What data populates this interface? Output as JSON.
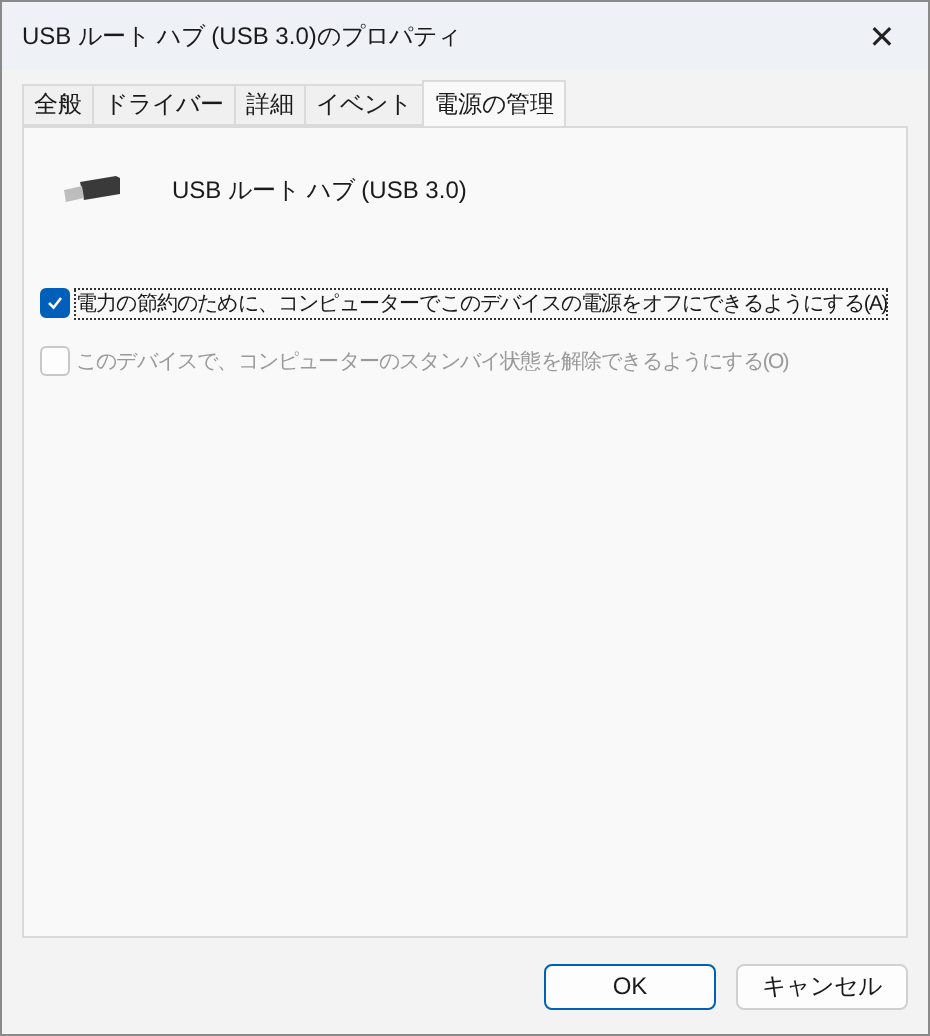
{
  "window": {
    "title": "USB ルート ハブ (USB 3.0)のプロパティ",
    "close": "✕"
  },
  "tabs": [
    {
      "label": "全般",
      "selected": false
    },
    {
      "label": "ドライバー",
      "selected": false
    },
    {
      "label": "詳細",
      "selected": false
    },
    {
      "label": "イベント",
      "selected": false
    },
    {
      "label": "電源の管理",
      "selected": true
    }
  ],
  "device": {
    "name": "USB ルート ハブ (USB 3.0)"
  },
  "options": [
    {
      "label": "電力の節約のために、コンピューターでこのデバイスの電源をオフにできるようにする(A)",
      "checked": true,
      "disabled": false,
      "focused": true
    },
    {
      "label": "このデバイスで、コンピューターのスタンバイ状態を解除できるようにする(O)",
      "checked": false,
      "disabled": true,
      "focused": false
    }
  ],
  "buttons": [
    {
      "label": "OK",
      "default": true
    },
    {
      "label": "キャンセル",
      "default": false
    }
  ]
}
